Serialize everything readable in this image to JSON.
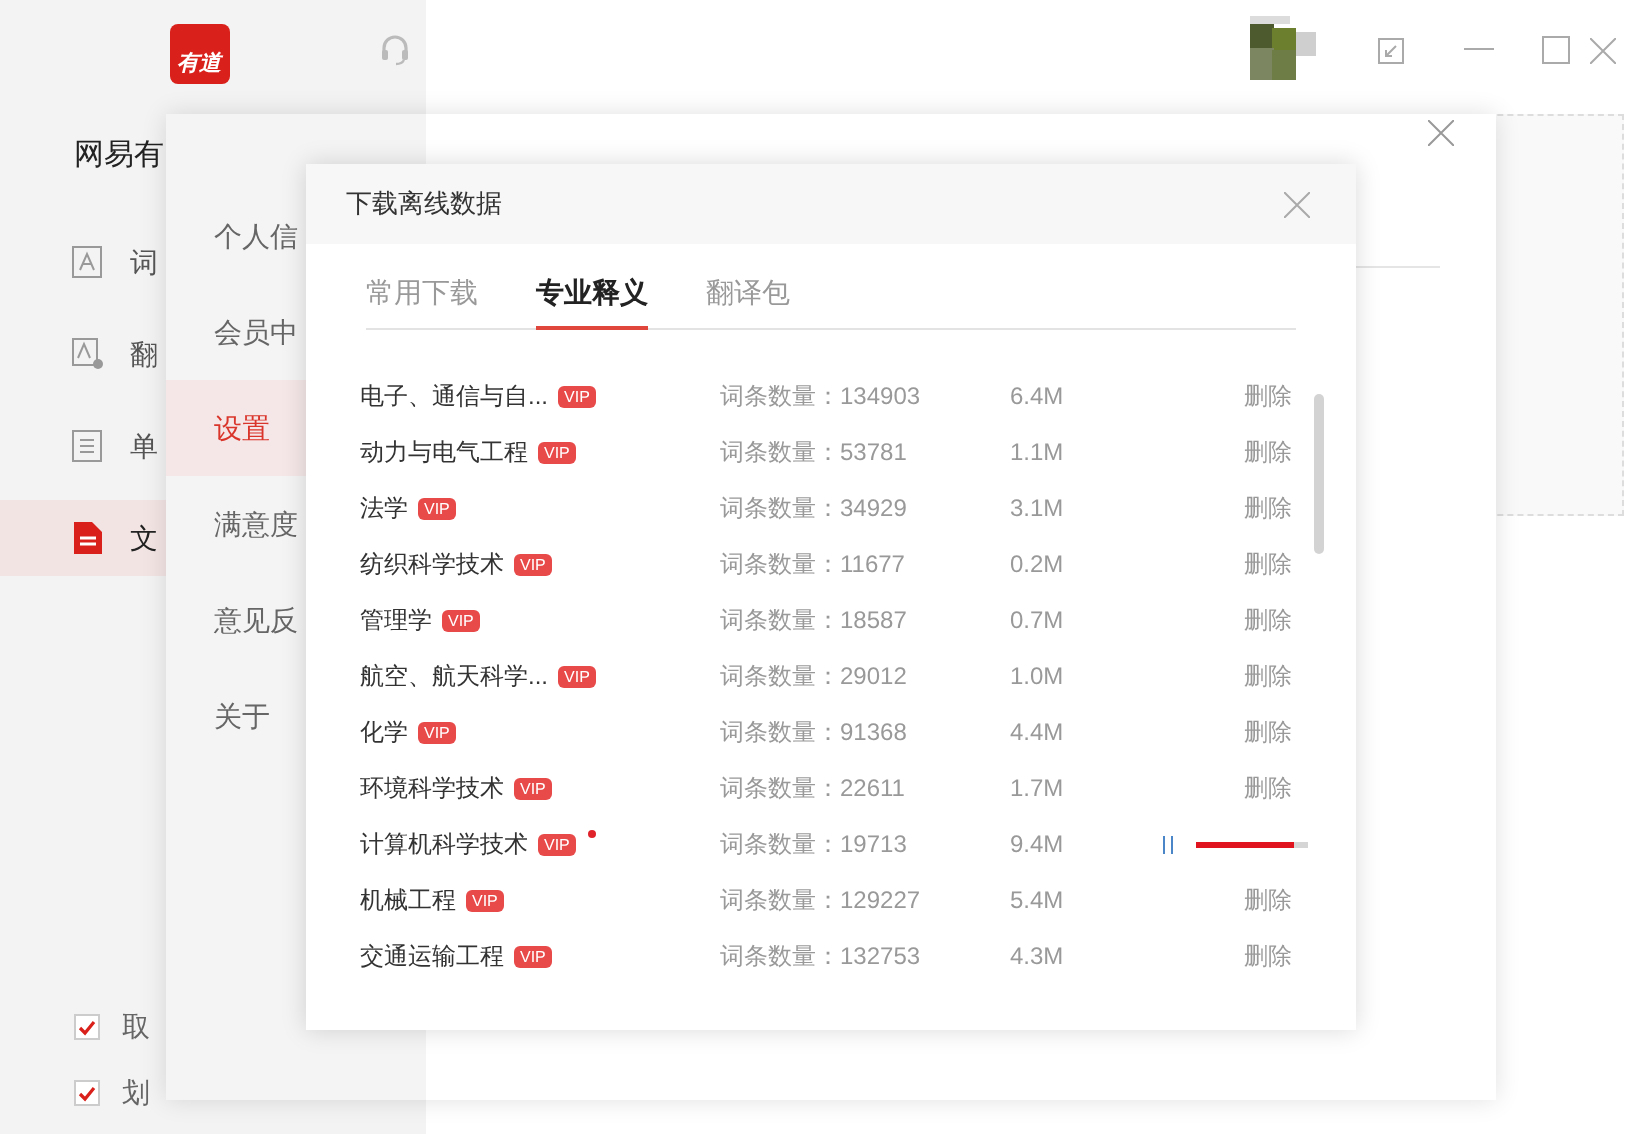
{
  "app": {
    "logo": "有道",
    "title": "网易有",
    "nav": [
      {
        "label": "词",
        "kind": "letter",
        "selected": false
      },
      {
        "label": "翻",
        "kind": "translate",
        "selected": false
      },
      {
        "label": "单",
        "kind": "list",
        "selected": false
      },
      {
        "label": "文",
        "kind": "doc",
        "selected": true
      }
    ],
    "options": [
      {
        "label": "取",
        "checked": true
      },
      {
        "label": "划",
        "checked": true
      }
    ]
  },
  "settings": {
    "menu": [
      {
        "label": "个人信",
        "selected": false
      },
      {
        "label": "会员中",
        "selected": false
      },
      {
        "label": "设置",
        "selected": true
      },
      {
        "label": "满意度",
        "selected": false
      },
      {
        "label": "意见反",
        "selected": false
      },
      {
        "label": "关于",
        "selected": false
      }
    ]
  },
  "download_dialog": {
    "title": "下载离线数据",
    "tabs": [
      {
        "label": "常用下载",
        "selected": false
      },
      {
        "label": "专业释义",
        "selected": true
      },
      {
        "label": "翻译包",
        "selected": false
      }
    ],
    "rows": [
      {
        "name": "电子、通信与自...",
        "badge": "VIP",
        "count": "词条数量：134903",
        "size": "6.4M",
        "kind": "installed",
        "action": "删除"
      },
      {
        "name": "动力与电气工程",
        "badge": "VIP",
        "count": "词条数量：53781",
        "size": "1.1M",
        "kind": "installed",
        "action": "删除"
      },
      {
        "name": "法学",
        "badge": "VIP",
        "count": "词条数量：34929",
        "size": "3.1M",
        "kind": "installed",
        "action": "删除"
      },
      {
        "name": "纺织科学技术",
        "badge": "VIP",
        "count": "词条数量：11677",
        "size": "0.2M",
        "kind": "installed",
        "action": "删除"
      },
      {
        "name": "管理学",
        "badge": "VIP",
        "count": "词条数量：18587",
        "size": "0.7M",
        "kind": "installed",
        "action": "删除"
      },
      {
        "name": "航空、航天科学...",
        "badge": "VIP",
        "count": "词条数量：29012",
        "size": "1.0M",
        "kind": "installed",
        "action": "删除"
      },
      {
        "name": "化学",
        "badge": "VIP",
        "count": "词条数量：91368",
        "size": "4.4M",
        "kind": "installed",
        "action": "删除"
      },
      {
        "name": "环境科学技术",
        "badge": "VIP",
        "count": "词条数量：22611",
        "size": "1.7M",
        "kind": "installed",
        "action": "删除"
      },
      {
        "name": "计算机科学技术",
        "badge": "VIP",
        "new": true,
        "count": "词条数量：19713",
        "size": "9.4M",
        "kind": "downloading",
        "level": 0.87
      },
      {
        "name": "机械工程",
        "badge": "VIP",
        "count": "词条数量：129227",
        "size": "5.4M",
        "kind": "installed",
        "action": "删除"
      },
      {
        "name": "交通运输工程",
        "badge": "VIP",
        "count": "词条数量：132753",
        "size": "4.3M",
        "kind": "installed",
        "action": "删除"
      }
    ]
  }
}
